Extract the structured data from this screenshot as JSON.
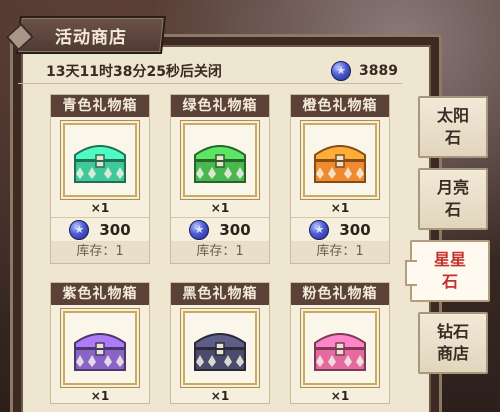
{
  "title": "活动商店",
  "countdown": "13天11时38分25秒后关闭",
  "currency": {
    "icon": "star-stone-icon",
    "value": "3889"
  },
  "items": [
    {
      "name": "青色礼物箱",
      "color": "#3ec99b",
      "qty": "×1",
      "price": "300",
      "stock": "库存：1"
    },
    {
      "name": "绿色礼物箱",
      "color": "#49b84f",
      "qty": "×1",
      "price": "300",
      "stock": "库存：1"
    },
    {
      "name": "橙色礼物箱",
      "color": "#f08a2c",
      "qty": "×1",
      "price": "300",
      "stock": "库存：1"
    },
    {
      "name": "紫色礼物箱",
      "color": "#8a63c7",
      "qty": "×1",
      "price": "",
      "stock": ""
    },
    {
      "name": "黑色礼物箱",
      "color": "#4b4a6a",
      "qty": "×1",
      "price": "",
      "stock": ""
    },
    {
      "name": "粉色礼物箱",
      "color": "#e46aa0",
      "qty": "×1",
      "price": "",
      "stock": ""
    }
  ],
  "tabs": [
    {
      "label": "太阳石",
      "lines": [
        "太阳",
        "石"
      ],
      "active": false
    },
    {
      "label": "月亮石",
      "lines": [
        "月亮",
        "石"
      ],
      "active": false
    },
    {
      "label": "星星石",
      "lines": [
        "星星",
        "石"
      ],
      "active": true
    },
    {
      "label": "钻石商店",
      "lines": [
        "钻石",
        "商店"
      ],
      "active": false
    }
  ],
  "colors": {
    "active_tab_text": "#c4322c",
    "header_bg": "#5a4238"
  }
}
